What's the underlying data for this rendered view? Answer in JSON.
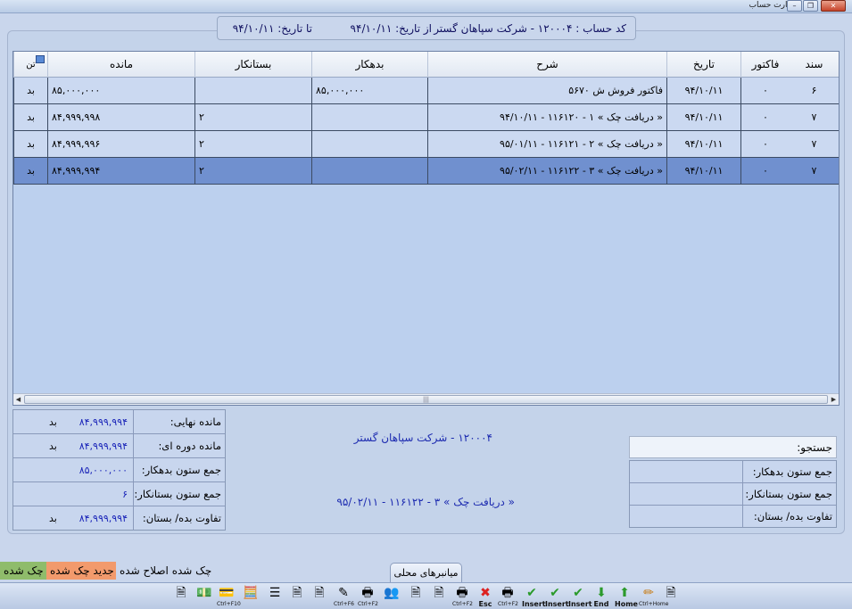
{
  "window": {
    "title": "کارت حساب",
    "min": "–",
    "restore": "❐",
    "close": "✕"
  },
  "header": {
    "account": "کد حساب : ۱۲۰۰۰۴ - شرکت سپاهان گستر",
    "from": "از تاریخ: ۹۴/۱۰/۱۱",
    "to": "تا تاریخ: ۹۴/۱۰/۱۱"
  },
  "grid": {
    "columns": {
      "sanad": "سند",
      "factor": "فاکتور",
      "date": "تاریخ",
      "desc": "شرح",
      "debit": "بدهکار",
      "credit": "بستانکار",
      "balance": "مانده",
      "last": "تن"
    },
    "rows": [
      {
        "sanad": "۶",
        "factor": "۰",
        "date": "۹۴/۱۰/۱۱",
        "desc": "فاکتور فروش ش ۵۶۷۰",
        "debit": "۸۵,۰۰۰,۰۰۰",
        "credit": "",
        "balance": "۸۵,۰۰۰,۰۰۰",
        "dir": "بد"
      },
      {
        "sanad": "۷",
        "factor": "۰",
        "date": "۹۴/۱۰/۱۱",
        "desc": "« دریافت چک » ۱ - ۱۱۶۱۲۰ - ۹۴/۱۰/۱۱",
        "debit": "",
        "credit": "۲",
        "balance": "۸۴,۹۹۹,۹۹۸",
        "dir": "بد"
      },
      {
        "sanad": "۷",
        "factor": "۰",
        "date": "۹۴/۱۰/۱۱",
        "desc": "« دریافت چک » ۲ - ۱۱۶۱۲۱ - ۹۵/۰۱/۱۱",
        "debit": "",
        "credit": "۲",
        "balance": "۸۴,۹۹۹,۹۹۶",
        "dir": "بد"
      },
      {
        "sanad": "۷",
        "factor": "۰",
        "date": "۹۴/۱۰/۱۱",
        "desc": "« دریافت چک » ۳ - ۱۱۶۱۲۲ - ۹۵/۰۲/۱۱",
        "debit": "",
        "credit": "۲",
        "balance": "۸۴,۹۹۹,۹۹۴",
        "dir": "بد",
        "selected": true
      }
    ]
  },
  "summary": {
    "final_label": "مانده نهایی:",
    "final_value": "۸۴,۹۹۹,۹۹۴",
    "final_dir": "بد",
    "period_label": "مانده دوره ای:",
    "period_value": "۸۴,۹۹۹,۹۹۴",
    "period_dir": "بد",
    "debit_sum_label": "جمع ستون بدهکار:",
    "debit_sum_value": "۸۵,۰۰۰,۰۰۰",
    "credit_sum_label": "جمع ستون بستانکار:",
    "credit_sum_value": "۶",
    "diff_label": "تفاوت بده/ بستان:",
    "diff_value": "۸۴,۹۹۹,۹۹۴",
    "diff_dir": "بد"
  },
  "middle": {
    "account": "۱۲۰۰۰۴ - شرکت سپاهان گستر",
    "selected_desc": "« دریافت چک » ۳ - ۱۱۶۱۲۲ - ۹۵/۰۲/۱۱"
  },
  "search": {
    "label": "جستجو:"
  },
  "right_summary": {
    "debit_sum_label": "جمع ستون بدهکار:",
    "credit_sum_label": "جمع ستون بستانکار:",
    "diff_label": "تفاوت بده/ بستان:"
  },
  "legend": {
    "checked": "چک شده",
    "new_checked": "جدید چک شده",
    "corrected": "چک شده اصلاح شده"
  },
  "legend_colors": {
    "checked": "#8fbc6b",
    "new_checked": "#f29a6c",
    "corrected": "#c9d6ec"
  },
  "tab": {
    "label": "میانبرهای محلی"
  },
  "toolbar": [
    {
      "name": "document-icon",
      "glyph": "🗎",
      "cap": ""
    },
    {
      "name": "money-icon",
      "glyph": "💵",
      "cap": ""
    },
    {
      "name": "payment-icon",
      "glyph": "💳",
      "cap": "Ctrl+F10"
    },
    {
      "name": "calculator-icon",
      "glyph": "🧮",
      "cap": ""
    },
    {
      "name": "list-icon",
      "glyph": "☰",
      "cap": ""
    },
    {
      "name": "note-icon",
      "glyph": "🗎",
      "cap": ""
    },
    {
      "name": "notes-icon",
      "glyph": "🗎",
      "cap": ""
    },
    {
      "name": "edit-icon",
      "glyph": "✎",
      "cap": "Ctrl+F6"
    },
    {
      "name": "print-icon",
      "glyph": "🖶",
      "cap": "Ctrl+F2"
    },
    {
      "name": "users-icon",
      "glyph": "👥",
      "cap": ""
    },
    {
      "name": "document2-icon",
      "glyph": "🗎",
      "cap": ""
    },
    {
      "name": "document3-icon",
      "glyph": "🗎",
      "cap": ""
    },
    {
      "name": "print2-icon",
      "glyph": "🖶",
      "cap": "Ctrl+F2"
    },
    {
      "name": "cancel-icon",
      "glyph": "✖",
      "cap": "Esc"
    },
    {
      "name": "print3-icon",
      "glyph": "🖶",
      "cap": "Ctrl+F2"
    },
    {
      "name": "check-icon",
      "glyph": "✔",
      "cap": "Insert"
    },
    {
      "name": "check2-icon",
      "glyph": "✔",
      "cap": "Insert"
    },
    {
      "name": "check3-icon",
      "glyph": "✔",
      "cap": "Insert"
    },
    {
      "name": "end-icon",
      "glyph": "⬇",
      "cap": "End"
    },
    {
      "name": "home-icon",
      "glyph": "⬆",
      "cap": "Home"
    },
    {
      "name": "pencil-icon",
      "glyph": "✏",
      "cap": "Ctrl+Home"
    },
    {
      "name": "document4-icon",
      "glyph": "🗎",
      "cap": ""
    }
  ]
}
